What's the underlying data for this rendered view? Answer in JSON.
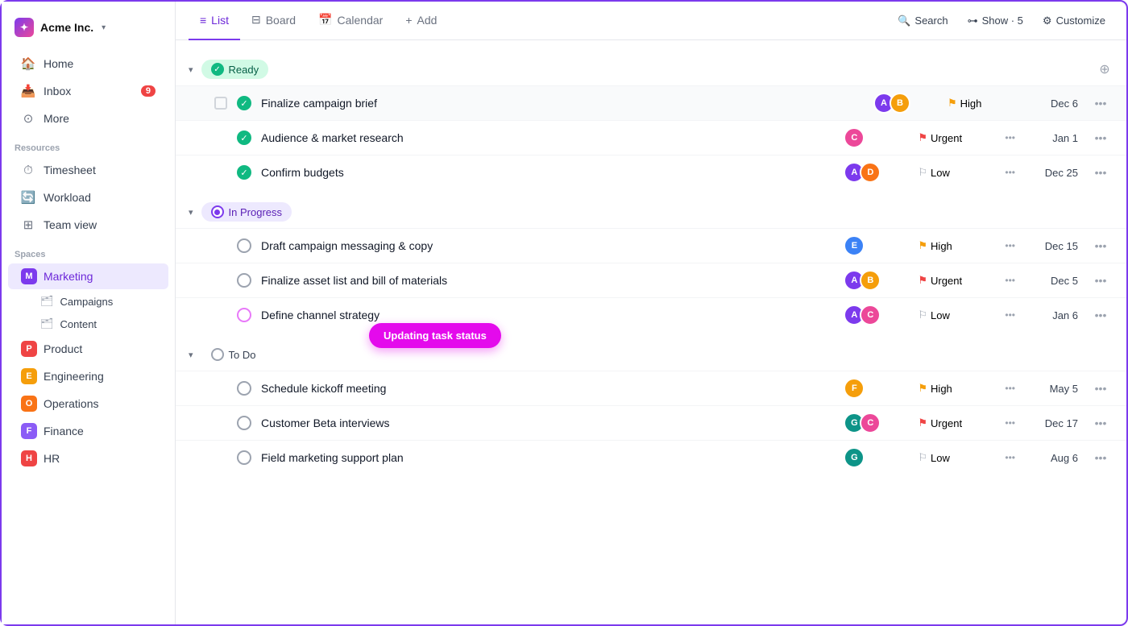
{
  "app": {
    "name": "Acme Inc.",
    "logo_letter": "✦"
  },
  "sidebar": {
    "nav_items": [
      {
        "id": "home",
        "label": "Home",
        "icon": "🏠"
      },
      {
        "id": "inbox",
        "label": "Inbox",
        "icon": "📥",
        "badge": 9
      },
      {
        "id": "more",
        "label": "More",
        "icon": "⊙"
      }
    ],
    "resources_label": "Resources",
    "resources": [
      {
        "id": "timesheet",
        "label": "Timesheet",
        "icon": "⏱"
      },
      {
        "id": "workload",
        "label": "Workload",
        "icon": "🔄"
      },
      {
        "id": "teamview",
        "label": "Team view",
        "icon": "⊞"
      }
    ],
    "spaces_label": "Spaces",
    "spaces": [
      {
        "id": "marketing",
        "label": "Marketing",
        "letter": "M",
        "color": "#7c3aed",
        "active": true
      },
      {
        "id": "product",
        "label": "Product",
        "letter": "P",
        "color": "#ef4444",
        "active": false
      },
      {
        "id": "engineering",
        "label": "Engineering",
        "letter": "E",
        "color": "#f59e0b",
        "active": false
      },
      {
        "id": "operations",
        "label": "Operations",
        "letter": "O",
        "color": "#f97316",
        "active": false
      },
      {
        "id": "finance",
        "label": "Finance",
        "letter": "F",
        "color": "#8b5cf6",
        "active": false
      },
      {
        "id": "hr",
        "label": "HR",
        "letter": "H",
        "color": "#ef4444",
        "active": false
      }
    ],
    "sub_items": [
      {
        "id": "campaigns",
        "label": "Campaigns"
      },
      {
        "id": "content",
        "label": "Content"
      }
    ]
  },
  "topbar": {
    "tabs": [
      {
        "id": "list",
        "label": "List",
        "icon": "≡",
        "active": true
      },
      {
        "id": "board",
        "label": "Board",
        "icon": "⊟",
        "active": false
      },
      {
        "id": "calendar",
        "label": "Calendar",
        "icon": "📅",
        "active": false
      },
      {
        "id": "add",
        "label": "Add",
        "icon": "+",
        "active": false
      }
    ],
    "search_label": "Search",
    "show_label": "Show · 5",
    "customize_label": "Customize"
  },
  "groups": [
    {
      "id": "ready",
      "label": "Ready",
      "type": "ready",
      "tasks": [
        {
          "id": "t1",
          "name": "Finalize campaign brief",
          "avatars": [
            "av-purple av-yellow"
          ],
          "priority": "High",
          "priority_type": "high",
          "date": "Dec 6",
          "has_checkbox": true
        },
        {
          "id": "t2",
          "name": "Audience & market research",
          "avatars": [
            "av-pink"
          ],
          "priority": "Urgent",
          "priority_type": "urgent",
          "date": "Jan 1",
          "has_checkbox": false
        },
        {
          "id": "t3",
          "name": "Confirm budgets",
          "avatars": [
            "av-purple av-orange"
          ],
          "priority": "Low",
          "priority_type": "low",
          "date": "Dec 25",
          "has_checkbox": false
        }
      ]
    },
    {
      "id": "in-progress",
      "label": "In Progress",
      "type": "inprogress",
      "tasks": [
        {
          "id": "t4",
          "name": "Draft campaign messaging & copy",
          "avatars": [
            "av-blue"
          ],
          "priority": "High",
          "priority_type": "high",
          "date": "Dec 15",
          "has_checkbox": false
        },
        {
          "id": "t5",
          "name": "Finalize asset list and bill of materials",
          "avatars": [
            "av-purple av-yellow"
          ],
          "priority": "Urgent",
          "priority_type": "urgent",
          "date": "Dec 5",
          "has_checkbox": false
        },
        {
          "id": "t6",
          "name": "Define channel strategy",
          "avatars": [
            "av-purple av-pink"
          ],
          "priority": "Low",
          "priority_type": "low",
          "date": "Jan 6",
          "has_checkbox": false,
          "tooltip": "Updating task status"
        }
      ]
    },
    {
      "id": "todo",
      "label": "To Do",
      "type": "todo",
      "tasks": [
        {
          "id": "t7",
          "name": "Schedule kickoff meeting",
          "avatars": [
            "av-yellow"
          ],
          "priority": "High",
          "priority_type": "high",
          "date": "May 5",
          "has_checkbox": false
        },
        {
          "id": "t8",
          "name": "Customer Beta interviews",
          "avatars": [
            "av-teal av-pink"
          ],
          "priority": "Urgent",
          "priority_type": "urgent",
          "date": "Dec 17",
          "has_checkbox": false
        },
        {
          "id": "t9",
          "name": "Field marketing support plan",
          "avatars": [
            "av-teal"
          ],
          "priority": "Low",
          "priority_type": "low",
          "date": "Aug 6",
          "has_checkbox": false
        }
      ]
    }
  ],
  "tooltip": {
    "label": "Updating task status"
  }
}
